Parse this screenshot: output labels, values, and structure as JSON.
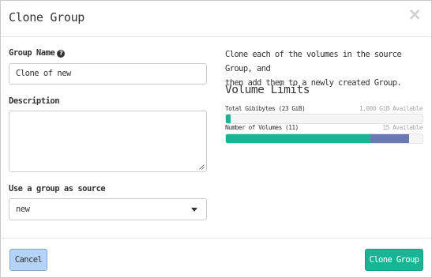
{
  "dialog": {
    "title": "Clone Group",
    "close_glyph": "×"
  },
  "form": {
    "group_name_label": "Group Name",
    "group_name_value": "Clone of new",
    "description_label": "Description",
    "description_value": "",
    "source_label": "Use a group as source",
    "source_selected": "new"
  },
  "help": {
    "text": "Clone each of the volumes in the source Group, and then add them to a newly created Group.",
    "line1": "Clone each of the volumes in the source Group, and",
    "line2": "then add them to a newly created Group."
  },
  "limits": {
    "title": "Volume Limits",
    "quotas": [
      {
        "label": "Total Gibibytes (23 GiB)",
        "available": "1,000 GiB Available",
        "used_fraction": 0.023,
        "added_fraction": 0.0
      },
      {
        "label": "Number of Volumes (11)",
        "available": "15 Available",
        "used_fraction": 0.733,
        "added_fraction": 0.2
      }
    ]
  },
  "footer": {
    "cancel_label": "Cancel",
    "submit_label": "Clone Group"
  },
  "colors": {
    "used": "#1ab394",
    "added": "#6a79b3",
    "cancel_bg": "#b5d3f5",
    "primary_bg": "#1ab394"
  },
  "icons": {
    "help": "question-circle-icon",
    "close": "close-icon",
    "select_caret": "caret-down-icon",
    "resize": "resize-grip-icon"
  }
}
